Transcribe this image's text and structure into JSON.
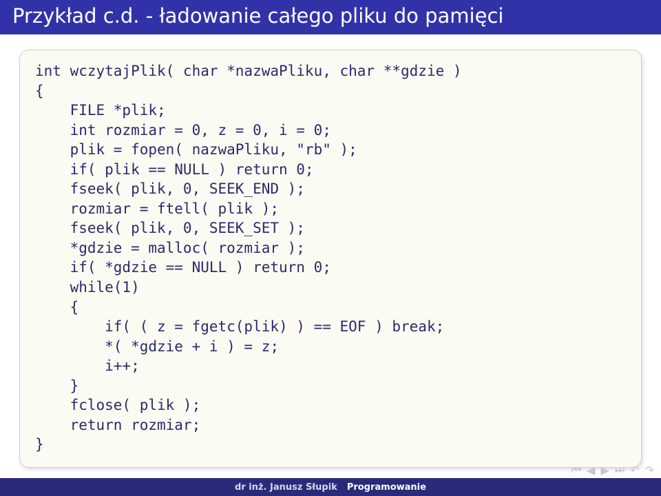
{
  "title": "Przykład c.d. - ładowanie całego pliku do pamięci",
  "code": "int wczytajPlik( char *nazwaPliku, char **gdzie )\n{\n    FILE *plik;\n    int rozmiar = 0, z = 0, i = 0;\n    plik = fopen( nazwaPliku, \"rb\" );\n    if( plik == NULL ) return 0;\n    fseek( plik, 0, SEEK_END );\n    rozmiar = ftell( plik );\n    fseek( plik, 0, SEEK_SET );\n    *gdzie = malloc( rozmiar );\n    if( *gdzie == NULL ) return 0;\n    while(1)\n    {\n        if( ( z = fgetc(plik) ) == EOF ) break;\n        *( *gdzie + i ) = z;\n        i++;\n    }\n    fclose( plik );\n    return rozmiar;\n}",
  "footer": {
    "author": "dr inż. Janusz Słupik",
    "course": "Programowanie"
  },
  "nav": {
    "first": "⏮",
    "prev": "◀",
    "next": "▶",
    "last": "⏭",
    "back": "↶",
    "forward": "↷"
  }
}
